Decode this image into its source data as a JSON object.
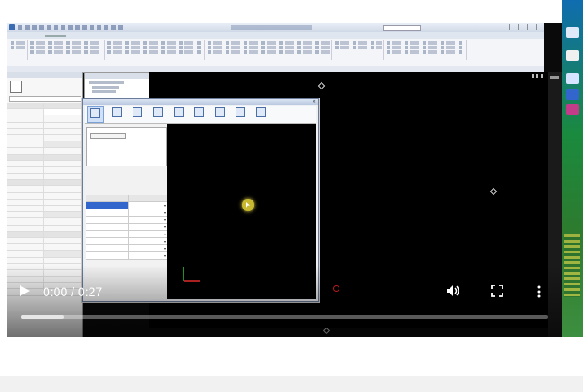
{
  "video": {
    "current_time": "0:00",
    "separator": " / ",
    "duration": "0:27",
    "played_fraction": 0.08,
    "controls": {
      "play_icon": "play-icon",
      "volume_icon": "volume-icon",
      "fullscreen_icon": "fullscreen-icon",
      "more_icon": "more-vertical-icon"
    }
  },
  "colors": {
    "ribbon_accent": "#4a6fa8",
    "selection": "#3366cc",
    "cursor_highlight": "#e8d84a",
    "marker": "#e02020",
    "axis_x": "#ff3030",
    "axis_y": "#30d030"
  }
}
